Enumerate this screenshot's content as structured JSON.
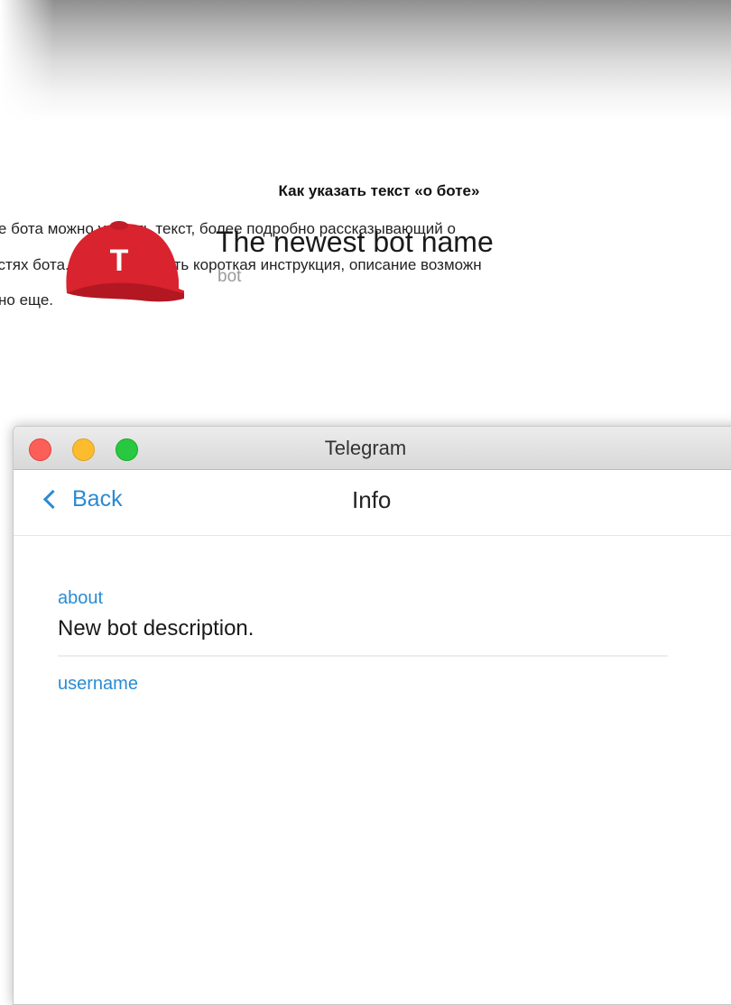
{
  "article": {
    "heading": "Как указать текст «о боте»",
    "lines": [
      "ле бота можно указать текст, более подробно рассказывающий о",
      "остях бота. Там может быть короткая инструкция, описание возможн",
      "но еще."
    ]
  },
  "window": {
    "title": "Telegram",
    "back_label": "Back",
    "nav_title": "Info"
  },
  "profile": {
    "name": "The newest bot name",
    "subtitle": "bot",
    "avatar_letter": "T",
    "avatar_color": "#d9232e"
  },
  "fields": {
    "about_label": "about",
    "about_value": "New bot description.",
    "username_label": "username"
  },
  "colors": {
    "accent": "#2a8bd2"
  }
}
